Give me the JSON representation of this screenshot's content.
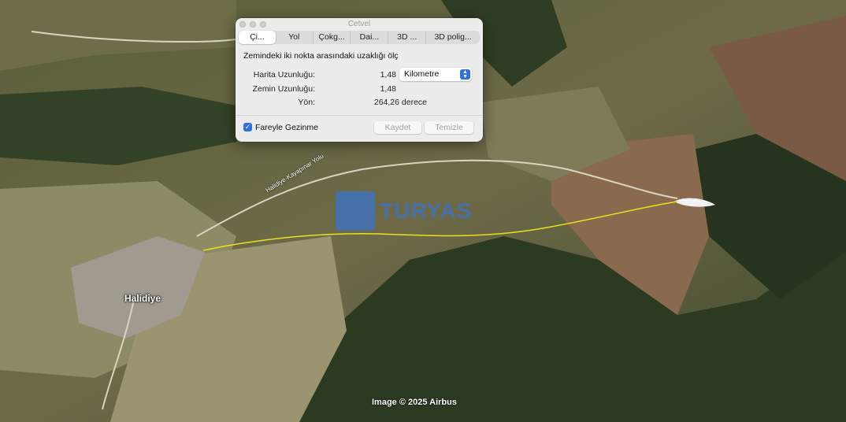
{
  "window": {
    "title": "Cetvel"
  },
  "tabs": [
    {
      "label": "Çi...",
      "active": true
    },
    {
      "label": "Yol",
      "active": false
    },
    {
      "label": "Çokg...",
      "active": false
    },
    {
      "label": "Dai...",
      "active": false
    },
    {
      "label": "3D ...",
      "active": false
    },
    {
      "label": "3D polig...",
      "active": false
    }
  ],
  "description": "Zemindeki iki nokta arasındaki uzaklığı ölç",
  "measurements": {
    "map_length": {
      "label": "Harita Uzunluğu:",
      "value": "1,48"
    },
    "ground_length": {
      "label": "Zemin Uzunluğu:",
      "value": "1,48"
    },
    "heading": {
      "label": "Yön:",
      "value": "264,26 derece"
    }
  },
  "unit": {
    "selected": "Kilometre"
  },
  "mouse_navigation": {
    "label": "Fareyle Gezinme",
    "checked": true
  },
  "buttons": {
    "save": "Kaydet",
    "clear": "Temizle"
  },
  "map": {
    "place_label": "Halidiye",
    "road_label": "Halidiye-Kayapınar Yolu",
    "watermark": "TURYAS",
    "credit": "Image © 2025 Airbus",
    "measure_line_color": "#e8e020"
  }
}
